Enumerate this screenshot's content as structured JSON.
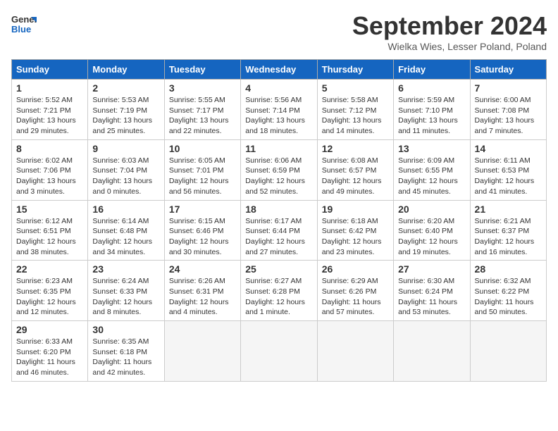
{
  "header": {
    "logo_line1": "General",
    "logo_line2": "Blue",
    "month": "September 2024",
    "location": "Wielka Wies, Lesser Poland, Poland"
  },
  "days_of_week": [
    "Sunday",
    "Monday",
    "Tuesday",
    "Wednesday",
    "Thursday",
    "Friday",
    "Saturday"
  ],
  "weeks": [
    [
      {
        "day": "1",
        "info": "Sunrise: 5:52 AM\nSunset: 7:21 PM\nDaylight: 13 hours\nand 29 minutes."
      },
      {
        "day": "2",
        "info": "Sunrise: 5:53 AM\nSunset: 7:19 PM\nDaylight: 13 hours\nand 25 minutes."
      },
      {
        "day": "3",
        "info": "Sunrise: 5:55 AM\nSunset: 7:17 PM\nDaylight: 13 hours\nand 22 minutes."
      },
      {
        "day": "4",
        "info": "Sunrise: 5:56 AM\nSunset: 7:14 PM\nDaylight: 13 hours\nand 18 minutes."
      },
      {
        "day": "5",
        "info": "Sunrise: 5:58 AM\nSunset: 7:12 PM\nDaylight: 13 hours\nand 14 minutes."
      },
      {
        "day": "6",
        "info": "Sunrise: 5:59 AM\nSunset: 7:10 PM\nDaylight: 13 hours\nand 11 minutes."
      },
      {
        "day": "7",
        "info": "Sunrise: 6:00 AM\nSunset: 7:08 PM\nDaylight: 13 hours\nand 7 minutes."
      }
    ],
    [
      {
        "day": "8",
        "info": "Sunrise: 6:02 AM\nSunset: 7:06 PM\nDaylight: 13 hours\nand 3 minutes."
      },
      {
        "day": "9",
        "info": "Sunrise: 6:03 AM\nSunset: 7:04 PM\nDaylight: 13 hours\nand 0 minutes."
      },
      {
        "day": "10",
        "info": "Sunrise: 6:05 AM\nSunset: 7:01 PM\nDaylight: 12 hours\nand 56 minutes."
      },
      {
        "day": "11",
        "info": "Sunrise: 6:06 AM\nSunset: 6:59 PM\nDaylight: 12 hours\nand 52 minutes."
      },
      {
        "day": "12",
        "info": "Sunrise: 6:08 AM\nSunset: 6:57 PM\nDaylight: 12 hours\nand 49 minutes."
      },
      {
        "day": "13",
        "info": "Sunrise: 6:09 AM\nSunset: 6:55 PM\nDaylight: 12 hours\nand 45 minutes."
      },
      {
        "day": "14",
        "info": "Sunrise: 6:11 AM\nSunset: 6:53 PM\nDaylight: 12 hours\nand 41 minutes."
      }
    ],
    [
      {
        "day": "15",
        "info": "Sunrise: 6:12 AM\nSunset: 6:51 PM\nDaylight: 12 hours\nand 38 minutes."
      },
      {
        "day": "16",
        "info": "Sunrise: 6:14 AM\nSunset: 6:48 PM\nDaylight: 12 hours\nand 34 minutes."
      },
      {
        "day": "17",
        "info": "Sunrise: 6:15 AM\nSunset: 6:46 PM\nDaylight: 12 hours\nand 30 minutes."
      },
      {
        "day": "18",
        "info": "Sunrise: 6:17 AM\nSunset: 6:44 PM\nDaylight: 12 hours\nand 27 minutes."
      },
      {
        "day": "19",
        "info": "Sunrise: 6:18 AM\nSunset: 6:42 PM\nDaylight: 12 hours\nand 23 minutes."
      },
      {
        "day": "20",
        "info": "Sunrise: 6:20 AM\nSunset: 6:40 PM\nDaylight: 12 hours\nand 19 minutes."
      },
      {
        "day": "21",
        "info": "Sunrise: 6:21 AM\nSunset: 6:37 PM\nDaylight: 12 hours\nand 16 minutes."
      }
    ],
    [
      {
        "day": "22",
        "info": "Sunrise: 6:23 AM\nSunset: 6:35 PM\nDaylight: 12 hours\nand 12 minutes."
      },
      {
        "day": "23",
        "info": "Sunrise: 6:24 AM\nSunset: 6:33 PM\nDaylight: 12 hours\nand 8 minutes."
      },
      {
        "day": "24",
        "info": "Sunrise: 6:26 AM\nSunset: 6:31 PM\nDaylight: 12 hours\nand 4 minutes."
      },
      {
        "day": "25",
        "info": "Sunrise: 6:27 AM\nSunset: 6:28 PM\nDaylight: 12 hours\nand 1 minute."
      },
      {
        "day": "26",
        "info": "Sunrise: 6:29 AM\nSunset: 6:26 PM\nDaylight: 11 hours\nand 57 minutes."
      },
      {
        "day": "27",
        "info": "Sunrise: 6:30 AM\nSunset: 6:24 PM\nDaylight: 11 hours\nand 53 minutes."
      },
      {
        "day": "28",
        "info": "Sunrise: 6:32 AM\nSunset: 6:22 PM\nDaylight: 11 hours\nand 50 minutes."
      }
    ],
    [
      {
        "day": "29",
        "info": "Sunrise: 6:33 AM\nSunset: 6:20 PM\nDaylight: 11 hours\nand 46 minutes."
      },
      {
        "day": "30",
        "info": "Sunrise: 6:35 AM\nSunset: 6:18 PM\nDaylight: 11 hours\nand 42 minutes."
      },
      {
        "day": "",
        "info": ""
      },
      {
        "day": "",
        "info": ""
      },
      {
        "day": "",
        "info": ""
      },
      {
        "day": "",
        "info": ""
      },
      {
        "day": "",
        "info": ""
      }
    ]
  ]
}
